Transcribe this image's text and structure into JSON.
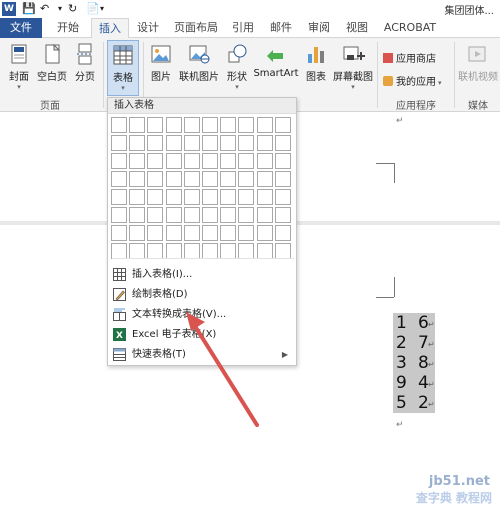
{
  "app": {
    "logo": "W",
    "window_title": "集团团体..."
  },
  "tabs": [
    {
      "label": "文件"
    },
    {
      "label": "开始"
    },
    {
      "label": "插入"
    },
    {
      "label": "设计"
    },
    {
      "label": "页面布局"
    },
    {
      "label": "引用"
    },
    {
      "label": "邮件"
    },
    {
      "label": "审阅"
    },
    {
      "label": "视图"
    },
    {
      "label": "ACROBAT"
    }
  ],
  "ribbon": {
    "pages_group": {
      "label": "页面",
      "buttons": [
        {
          "label": "封面",
          "icon": "cover-page-icon"
        },
        {
          "label": "空白页",
          "icon": "blank-page-icon"
        },
        {
          "label": "分页",
          "icon": "page-break-icon"
        }
      ]
    },
    "table_group": {
      "button": {
        "label": "表格",
        "icon": "table-icon"
      }
    },
    "illustrations_group": {
      "buttons": [
        {
          "label": "图片",
          "icon": "picture-icon"
        },
        {
          "label": "联机图片",
          "icon": "online-picture-icon"
        },
        {
          "label": "形状",
          "icon": "shapes-icon"
        },
        {
          "label": "SmartArt",
          "icon": "smartart-icon"
        },
        {
          "label": "图表",
          "icon": "chart-icon"
        },
        {
          "label": "屏幕截图",
          "icon": "screenshot-icon"
        }
      ]
    },
    "apps_group": {
      "label": "应用程序",
      "store": "应用商店",
      "my_apps": "我的应用"
    },
    "media_group": {
      "label": "媒体",
      "online_video": "联机视频"
    }
  },
  "dropdown": {
    "header": "插入表格",
    "items": [
      {
        "label": "插入表格(I)...",
        "icon": "insert-table-icon"
      },
      {
        "label": "绘制表格(D)",
        "icon": "draw-table-icon"
      },
      {
        "label": "文本转换成表格(V)...",
        "icon": "text-to-table-icon"
      },
      {
        "label": "Excel 电子表格(X)",
        "icon": "excel-icon"
      },
      {
        "label": "快速表格(T)",
        "icon": "quick-tables-icon",
        "has_submenu": true
      }
    ]
  },
  "document": {
    "para_mark": "↵",
    "rows": [
      {
        "a": "1",
        "b": "6"
      },
      {
        "a": "2",
        "b": "7"
      },
      {
        "a": "3",
        "b": "8"
      },
      {
        "a": "9",
        "b": "4"
      },
      {
        "a": "5",
        "b": "2"
      }
    ]
  },
  "watermark": {
    "line1": "jb51.net",
    "line2": "查字典 教程网"
  },
  "colors": {
    "brand": "#2b579a",
    "ribbon_bg": "#f3f3f3",
    "selection": "#c8c8c8",
    "arrow": "#d9534f"
  }
}
